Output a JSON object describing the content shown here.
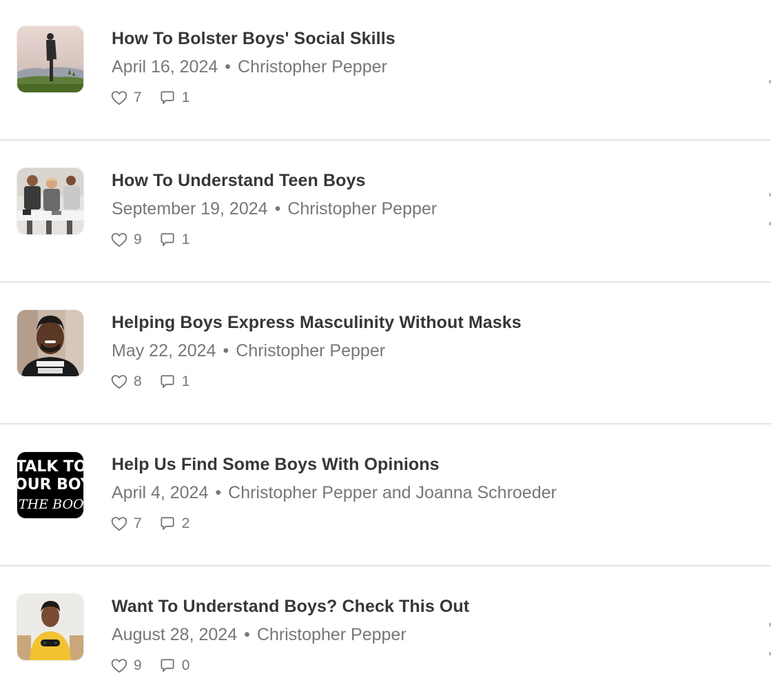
{
  "posts": [
    {
      "title": "How To Bolster Boys' Social Skills",
      "date": "April 16, 2024",
      "separator": "•",
      "author": "Christopher Pepper",
      "likes": "7",
      "comments": "1",
      "thumbnail_icon": "person-on-hill-photo"
    },
    {
      "title": "How To Understand Teen Boys",
      "date": "September 19, 2024",
      "separator": "•",
      "author": "Christopher Pepper",
      "likes": "9",
      "comments": "1",
      "thumbnail_icon": "three-teens-photo"
    },
    {
      "title": "Helping Boys Express Masculinity Without Masks",
      "date": "May 22, 2024",
      "separator": "•",
      "author": "Christopher Pepper",
      "likes": "8",
      "comments": "1",
      "thumbnail_icon": "smiling-man-photo"
    },
    {
      "title": "Help Us Find Some Boys With Opinions",
      "date": "April 4, 2024",
      "separator": "•",
      "author": "Christopher Pepper and Joanna Schroeder",
      "likes": "7",
      "comments": "2",
      "thumbnail_icon": "book-cover-graphic",
      "thumbnail_text": [
        "TALK TO",
        "OUR BOYS",
        "THE BOOK"
      ]
    },
    {
      "title": "Want To Understand Boys? Check This Out",
      "date": "August 28, 2024",
      "separator": "•",
      "author": "Christopher Pepper",
      "likes": "9",
      "comments": "0",
      "thumbnail_icon": "boy-with-controller-photo"
    }
  ],
  "colors": {
    "title": "#363737",
    "meta": "#777777",
    "divider": "#e4e4e4"
  }
}
